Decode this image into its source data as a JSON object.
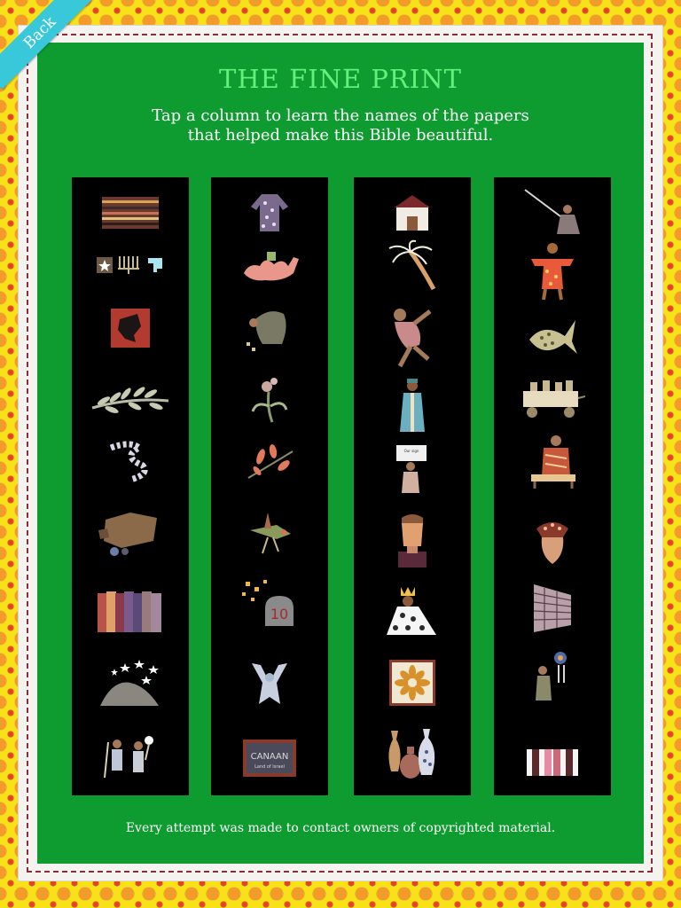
{
  "back_label": "Back",
  "title": "THE FINE PRINT",
  "subtitle_line1": "Tap a column to learn the names of the papers",
  "subtitle_line2": "that helped make this Bible beautiful.",
  "footer": "Every attempt was made to contact owners of copyrighted material.",
  "colors": {
    "panel": "#0e9b30",
    "title": "#63f07b",
    "back_badge": "#39c8d9",
    "columns": "#000000"
  },
  "columns": [
    {
      "items": [
        "striped-paper-icon",
        "star-menorah-icon",
        "map-icon",
        "olive-branch-icon",
        "staff-icon",
        "ark-icon",
        "color-swatches-icon",
        "stars-hill-icon",
        "two-figures-icon"
      ]
    },
    {
      "items": [
        "coat-icon",
        "camel-icon",
        "kneeling-figure-icon",
        "flower-icon",
        "leaves-branch-icon",
        "bird-icon",
        "ten-commandments-icon",
        "raised-arms-figure-icon",
        "canaan-sign-icon"
      ]
    },
    {
      "items": [
        "tent-icon",
        "palm-tree-icon",
        "dancer-icon",
        "robed-man-icon",
        "sign-holder-icon",
        "boy-portrait-icon",
        "queen-icon",
        "flower-tile-icon",
        "vases-icon"
      ]
    },
    {
      "items": [
        "fisherman-icon",
        "prophet-icon",
        "fish-icon",
        "cart-icon",
        "scribe-icon",
        "jar-icon",
        "wall-icon",
        "lamp-figure-icon",
        "striped-swatch-icon"
      ]
    }
  ]
}
